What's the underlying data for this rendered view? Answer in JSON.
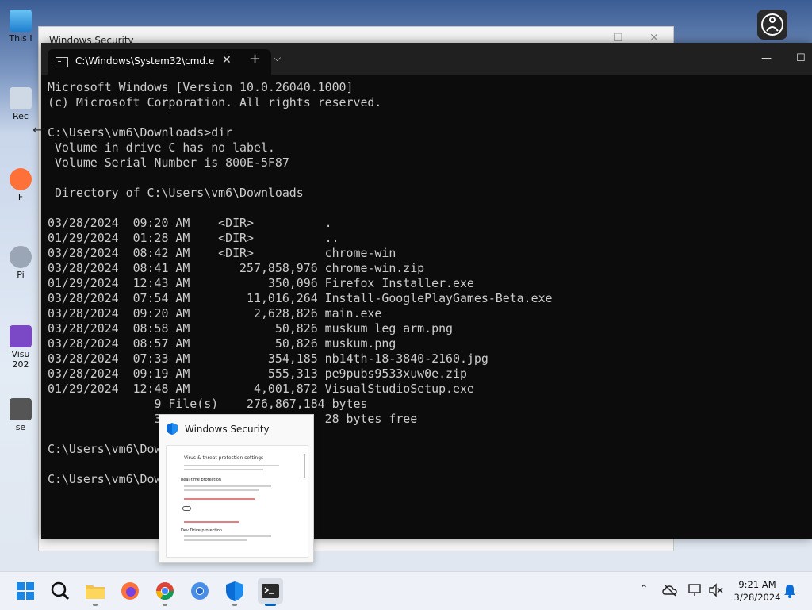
{
  "desktop": {
    "icon_labels": [
      "This I",
      "Rec",
      "F",
      "Pi",
      "Visu 202",
      "se"
    ]
  },
  "background_window": {
    "title": "Windows Security"
  },
  "terminal": {
    "tab_title": "C:\\Windows\\System32\\cmd.e",
    "new_tab": "+",
    "console_lines": [
      "Microsoft Windows [Version 10.0.26040.1000]",
      "(c) Microsoft Corporation. All rights reserved.",
      "",
      "C:\\Users\\vm6\\Downloads>dir",
      " Volume in drive C has no label.",
      " Volume Serial Number is 800E-5F87",
      "",
      " Directory of C:\\Users\\vm6\\Downloads",
      "",
      "03/28/2024  09:20 AM    <DIR>          .",
      "01/29/2024  01:28 AM    <DIR>          ..",
      "03/28/2024  08:42 AM    <DIR>          chrome-win",
      "03/28/2024  08:41 AM       257,858,976 chrome-win.zip",
      "01/29/2024  12:43 AM           350,096 Firefox Installer.exe",
      "03/28/2024  07:54 AM        11,016,264 Install-GooglePlayGames-Beta.exe",
      "03/28/2024  09:20 AM         2,628,826 main.exe",
      "03/28/2024  08:58 AM            50,826 muskum leg arm.png",
      "03/28/2024  08:57 AM            50,826 muskum.png",
      "03/28/2024  07:33 AM           354,185 nb14th-18-3840-2160.jpg",
      "03/28/2024  09:19 AM           555,313 pe9pubs9533xuw0e.zip",
      "01/29/2024  12:48 AM         4,001,872 VisualStudioSetup.exe",
      "               9 File(s)    276,867,184 bytes",
      "               3                       28 bytes free",
      "",
      "C:\\Users\\vm6\\Dow",
      "",
      "C:\\Users\\vm6\\Dow"
    ]
  },
  "thumbnail": {
    "title": "Windows Security",
    "preview_heading": "Virus & threat protection settings",
    "preview_section_1": "Real-time protection",
    "preview_section_2": "Dev Drive protection"
  },
  "taskbar": {
    "apps": [
      "start-icon",
      "search-icon",
      "file-explorer-icon",
      "firefox-icon",
      "chrome-icon",
      "chromium-icon",
      "windows-security-icon",
      "terminal-icon"
    ]
  },
  "clock": {
    "time": "9:21 AM",
    "date": "3/28/2024"
  },
  "colors": {
    "accent": "#005fb8",
    "console_bg": "#0c0c0c",
    "console_fg": "#cccccc"
  }
}
